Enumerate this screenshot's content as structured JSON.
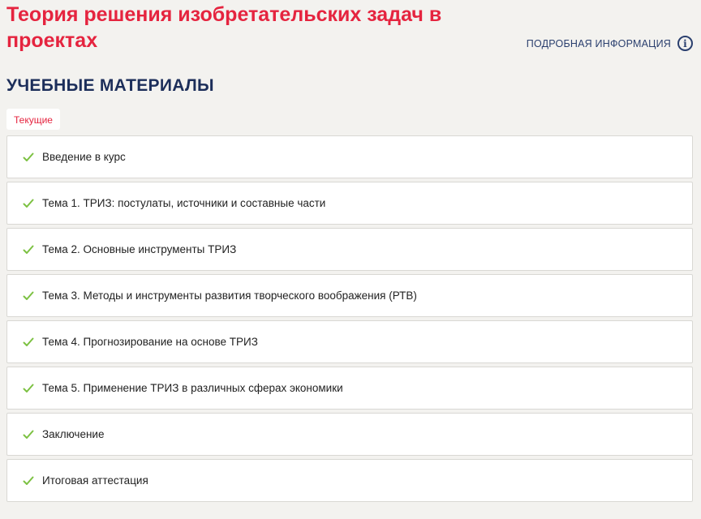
{
  "page": {
    "title": "Теория решения изобретательских задач в проектах",
    "info_link_label": "ПОДРОБНАЯ ИНФОРМАЦИЯ",
    "info_icon": "info-circle-icon",
    "section_heading": "УЧЕБНЫЕ МАТЕРИАЛЫ",
    "filter_tab": "Текущие"
  },
  "colors": {
    "accent": "#e5243f",
    "heading": "#1c2e5a",
    "check": "#7cc142",
    "background": "#f3f2ef"
  },
  "materials": [
    {
      "label": "Введение в курс",
      "status_icon": "checkmark-icon"
    },
    {
      "label": "Тема 1. ТРИЗ: постулаты, источники и составные части",
      "status_icon": "checkmark-icon"
    },
    {
      "label": "Тема 2. Основные инструменты ТРИЗ",
      "status_icon": "checkmark-icon"
    },
    {
      "label": "Тема 3. Методы и инструменты развития творческого воображения (РТВ)",
      "status_icon": "checkmark-icon"
    },
    {
      "label": "Тема 4. Прогнозирование на основе ТРИЗ",
      "status_icon": "checkmark-icon"
    },
    {
      "label": "Тема 5. Применение ТРИЗ в различных сферах экономики",
      "status_icon": "checkmark-icon"
    },
    {
      "label": "Заключение",
      "status_icon": "checkmark-icon"
    },
    {
      "label": "Итоговая аттестация",
      "status_icon": "checkmark-icon"
    }
  ]
}
